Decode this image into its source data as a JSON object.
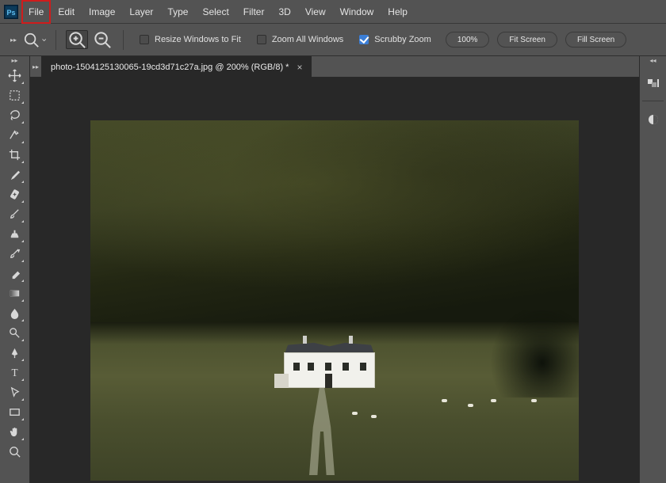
{
  "menu": {
    "items": [
      "File",
      "Edit",
      "Image",
      "Layer",
      "Type",
      "Select",
      "Filter",
      "3D",
      "View",
      "Window",
      "Help"
    ],
    "highlighted_index": 0
  },
  "options": {
    "resize_label": "Resize Windows to Fit",
    "zoom_all_label": "Zoom All Windows",
    "scrubby_label": "Scrubby Zoom",
    "scrubby_checked": true,
    "percent": "100%",
    "fit_screen": "Fit Screen",
    "fill_screen": "Fill Screen"
  },
  "tab": {
    "title": "photo-1504125130065-19cd3d71c27a.jpg @ 200% (RGB/8) *"
  },
  "tools": [
    {
      "name": "move-tool"
    },
    {
      "name": "marquee-tool"
    },
    {
      "name": "lasso-tool"
    },
    {
      "name": "quick-select-tool"
    },
    {
      "name": "crop-tool"
    },
    {
      "name": "eyedropper-tool"
    },
    {
      "name": "healing-brush-tool"
    },
    {
      "name": "brush-tool"
    },
    {
      "name": "clone-stamp-tool"
    },
    {
      "name": "history-brush-tool"
    },
    {
      "name": "eraser-tool"
    },
    {
      "name": "gradient-tool"
    },
    {
      "name": "blur-tool"
    },
    {
      "name": "dodge-tool"
    },
    {
      "name": "pen-tool"
    },
    {
      "name": "type-tool"
    },
    {
      "name": "path-select-tool"
    },
    {
      "name": "rectangle-tool"
    },
    {
      "name": "hand-tool"
    },
    {
      "name": "zoom-tool"
    }
  ]
}
